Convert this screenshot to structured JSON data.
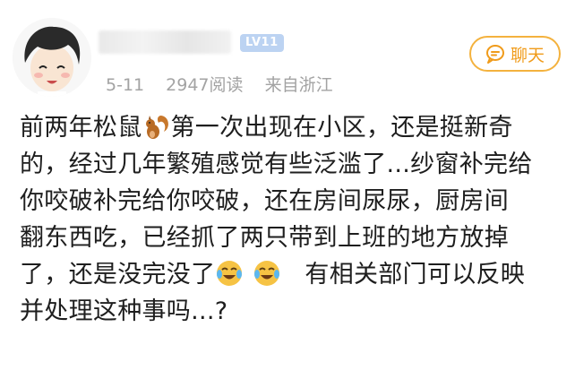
{
  "post": {
    "level": "LV11",
    "meta": {
      "date": "5-11",
      "reads": "2947阅读",
      "source": "来自浙江"
    },
    "chat_label": "聊天",
    "lines": [
      [
        "前两年松鼠",
        "第一次出现在小区，还是挺新奇"
      ],
      "的，经过几年繁殖感觉有些泛滥了...纱窗补完给",
      "你咬破补完给你咬破，还在房间尿尿，厨房间",
      "翻东西吃，已经抓了两只带到上班的地方放掉",
      [
        "了，还是没完没了",
        "有相关部门可以反映"
      ],
      "并处理这种事吗...?"
    ],
    "icons": {
      "squirrel": "squirrel-emoji",
      "crying": "crying-laughing-emoji",
      "chat": "chat-bubble-icon"
    }
  }
}
